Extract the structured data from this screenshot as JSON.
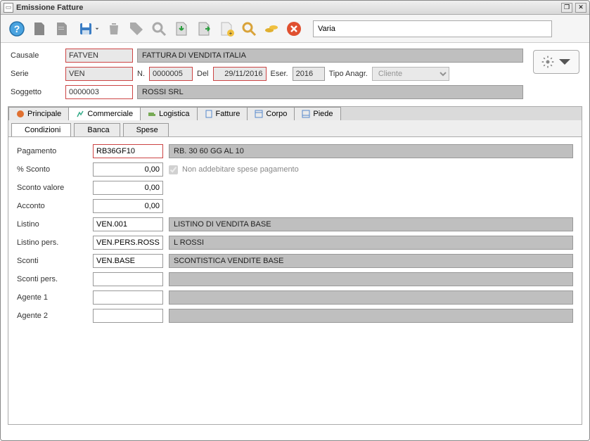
{
  "window": {
    "title": "Emissione Fatture"
  },
  "toolbar": {
    "search_value": "Varia"
  },
  "header": {
    "causale_label": "Causale",
    "causale_value": "FATVEN",
    "causale_desc": "FATTURA DI VENDITA ITALIA",
    "serie_label": "Serie",
    "serie_value": "VEN",
    "n_label": "N.",
    "n_value": "0000005",
    "del_label": "Del",
    "del_value": "29/11/2016",
    "eser_label": "Eser.",
    "eser_value": "2016",
    "tipo_label": "Tipo Anagr.",
    "tipo_value": "Cliente",
    "soggetto_label": "Soggetto",
    "soggetto_value": "0000003",
    "soggetto_desc": "ROSSI SRL"
  },
  "tabs": {
    "principale": "Principale",
    "commerciale": "Commerciale",
    "logistica": "Logistica",
    "fatture": "Fatture",
    "corpo": "Corpo",
    "piede": "Piede"
  },
  "subtabs": {
    "condizioni": "Condizioni",
    "banca": "Banca",
    "spese": "Spese"
  },
  "fields": {
    "pagamento_label": "Pagamento",
    "pagamento_value": "RB36GF10",
    "pagamento_desc": "RB. 30 60 GG AL 10",
    "sconto_pct_label": "% Sconto",
    "sconto_pct_value": "0,00",
    "spese_check_label": "Non addebitare spese pagamento",
    "sconto_val_label": "Sconto valore",
    "sconto_val_value": "0,00",
    "acconto_label": "Acconto",
    "acconto_value": "0,00",
    "listino_label": "Listino",
    "listino_value": "VEN.001",
    "listino_desc": "LISTINO DI VENDITA BASE",
    "listino_pers_label": "Listino pers.",
    "listino_pers_value": "VEN.PERS.ROSS",
    "listino_pers_desc": "L ROSSI",
    "sconti_label": "Sconti",
    "sconti_value": "VEN.BASE",
    "sconti_desc": "SCONTISTICA VENDITE BASE",
    "sconti_pers_label": "Sconti pers.",
    "sconti_pers_value": "",
    "sconti_pers_desc": "",
    "agente1_label": "Agente 1",
    "agente1_value": "",
    "agente1_desc": "",
    "agente2_label": "Agente 2",
    "agente2_value": "",
    "agente2_desc": ""
  }
}
